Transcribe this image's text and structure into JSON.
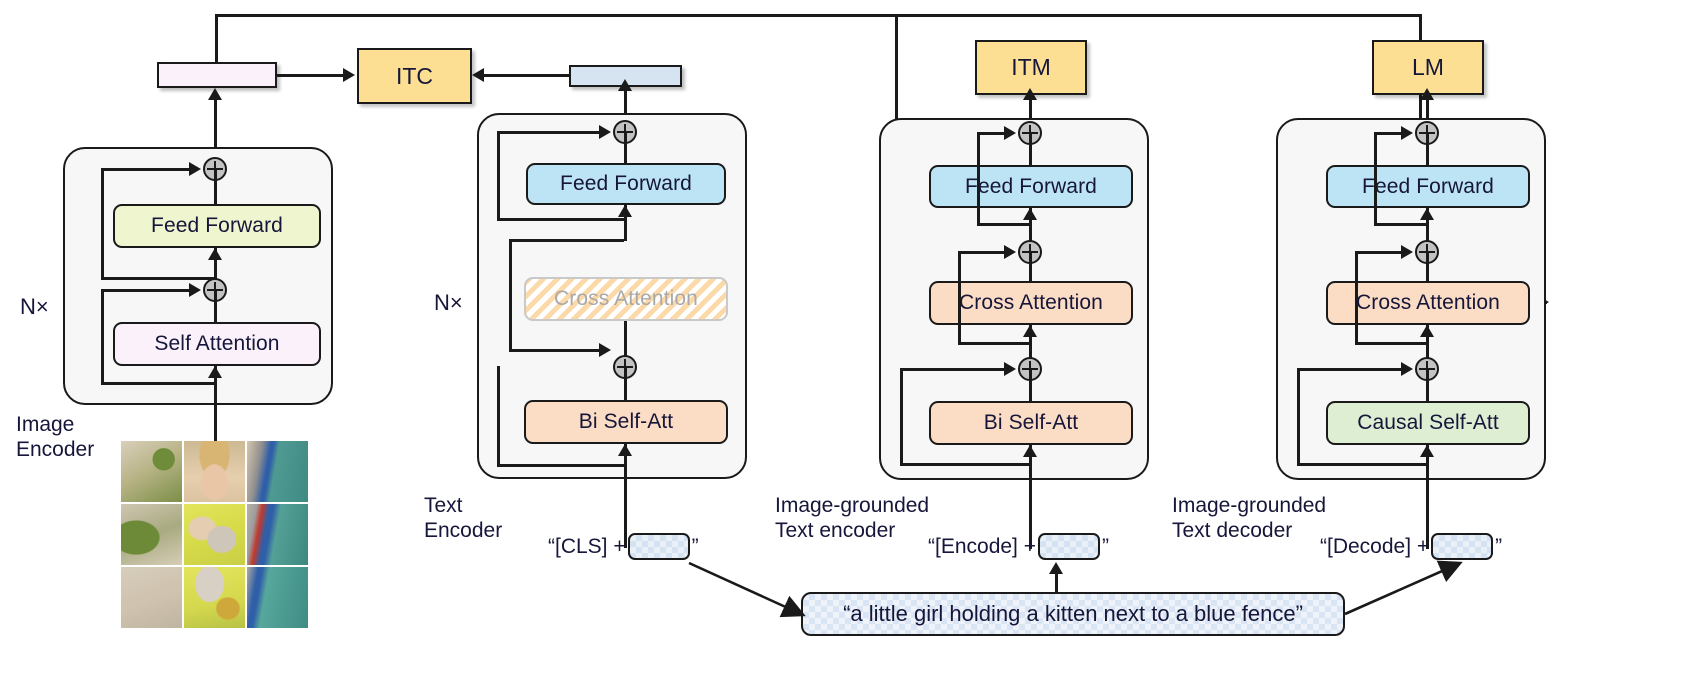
{
  "diagram": {
    "title": "BLIP pre-training model architecture and objectives",
    "repeat_label": "N×",
    "colors": {
      "objective": "#fcdf92",
      "feed_forward_image": "#eef5cf",
      "self_attention_image": "#faf1fa",
      "feed_forward_text": "#bde4f4",
      "bi_self_attention": "#fbdcc4",
      "cross_attention": "#fbdcc4",
      "causal_self_attention": "#ddeed3",
      "cross_attention_disabled": "#c9c9c9",
      "image_feature_bar": "#faf1fa",
      "text_feature_bar": "#d6e4f2",
      "line": "#1a1a1a"
    }
  },
  "objectives": {
    "itc": "ITC",
    "itm": "ITM",
    "lm": "LM"
  },
  "columns": [
    {
      "id": "image-encoder",
      "caption_line1": "Image",
      "caption_line2": "Encoder",
      "repeat": "N×",
      "modules": [
        {
          "id": "feed-forward",
          "label": "Feed Forward",
          "state": "active"
        },
        {
          "id": "self-attention",
          "label": "Self Attention",
          "state": "active"
        }
      ],
      "output_objective": "ITC"
    },
    {
      "id": "text-encoder",
      "caption_line1": "Text",
      "caption_line2": "Encoder",
      "repeat": "N×",
      "modules": [
        {
          "id": "feed-forward",
          "label": "Feed Forward",
          "state": "active"
        },
        {
          "id": "cross-attention",
          "label": "Cross Attention",
          "state": "disabled"
        },
        {
          "id": "bi-self-att",
          "label": "Bi Self-Att",
          "state": "active"
        }
      ],
      "prompt_prefix": "“[CLS] +",
      "prompt_suffix": "”",
      "output_objective": "ITC"
    },
    {
      "id": "image-grounded-text-encoder",
      "caption_line1": "Image-grounded",
      "caption_line2": "Text encoder",
      "repeat": "",
      "modules": [
        {
          "id": "feed-forward",
          "label": "Feed Forward",
          "state": "active"
        },
        {
          "id": "cross-attention",
          "label": "Cross Attention",
          "state": "active"
        },
        {
          "id": "bi-self-att",
          "label": "Bi Self-Att",
          "state": "active"
        }
      ],
      "prompt_prefix": "“[Encode] +",
      "prompt_suffix": "”",
      "output_objective": "ITM"
    },
    {
      "id": "image-grounded-text-decoder",
      "caption_line1": "Image-grounded",
      "caption_line2": "Text decoder",
      "repeat": "",
      "modules": [
        {
          "id": "feed-forward",
          "label": "Feed Forward",
          "state": "active"
        },
        {
          "id": "cross-attention",
          "label": "Cross Attention",
          "state": "active"
        },
        {
          "id": "causal-self-att",
          "label": "Causal Self-Att",
          "state": "active"
        }
      ],
      "prompt_prefix": "“[Decode] +",
      "prompt_suffix": "”",
      "output_objective": "LM"
    }
  ],
  "caption": {
    "text": "“a little girl holding a kitten next to a blue fence”"
  },
  "image_input": {
    "alt": "photo of a little girl holding a kitten next to a blue fence, split into 3x3 patches",
    "grid_rows": 3,
    "grid_cols": 3
  }
}
